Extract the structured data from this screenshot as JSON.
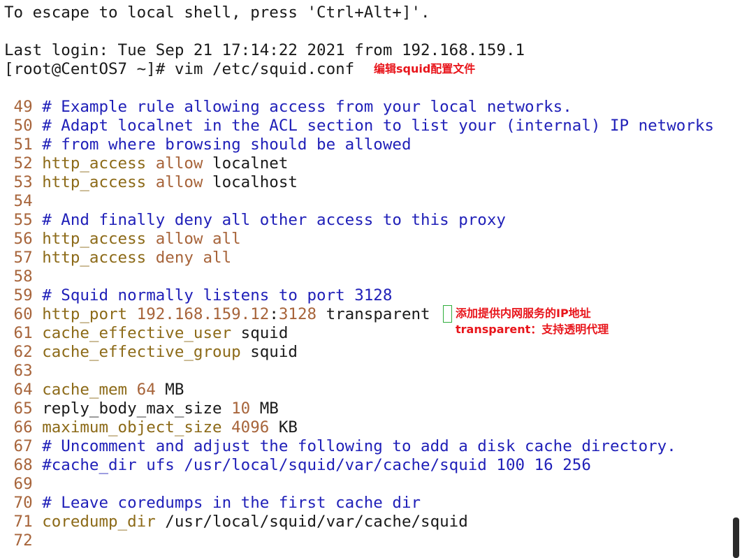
{
  "terminal": {
    "escape_notice": "To escape to local shell, press 'Ctrl+Alt+]'.",
    "last_login": "Last login: Tue Sep 21 17:14:22 2021 from 192.168.159.1",
    "prompt": "[root@CentOS7 ~]# vim /etc/squid.conf"
  },
  "annotations": {
    "edit_config": "编辑squid配置文件",
    "ip_note": "添加提供内网服务的IP地址",
    "transparent_note": "transparent：支持透明代理"
  },
  "colors": {
    "comment": "#1f1fb8",
    "keyword": "#8c6a18",
    "value": "#a7643a",
    "line_number": "#a7643a",
    "annotation": "#e8151b",
    "cursor": "#2fae3c"
  },
  "file_lines": [
    {
      "num": " 49",
      "tokens": [
        {
          "t": "# Example rule allowing access from your local networks.",
          "c": "comment"
        }
      ]
    },
    {
      "num": " 50",
      "tokens": [
        {
          "t": "# Adapt localnet in the ACL section to list your (internal) IP networks",
          "c": "comment"
        }
      ]
    },
    {
      "num": " 51",
      "tokens": [
        {
          "t": "# from where browsing should be allowed",
          "c": "comment"
        }
      ]
    },
    {
      "num": " 52",
      "tokens": [
        {
          "t": "http_access ",
          "c": "key"
        },
        {
          "t": "allow",
          "c": "val"
        },
        {
          "t": " localnet",
          "c": "plain"
        }
      ]
    },
    {
      "num": " 53",
      "tokens": [
        {
          "t": "http_access ",
          "c": "key"
        },
        {
          "t": "allow",
          "c": "val"
        },
        {
          "t": " localhost",
          "c": "plain"
        }
      ]
    },
    {
      "num": " 54",
      "tokens": []
    },
    {
      "num": " 55",
      "tokens": [
        {
          "t": "# And finally deny all other access to this proxy",
          "c": "comment"
        }
      ]
    },
    {
      "num": " 56",
      "tokens": [
        {
          "t": "http_access ",
          "c": "key"
        },
        {
          "t": "allow all",
          "c": "val"
        }
      ]
    },
    {
      "num": " 57",
      "tokens": [
        {
          "t": "http_access ",
          "c": "key"
        },
        {
          "t": "deny all",
          "c": "val"
        }
      ]
    },
    {
      "num": " 58",
      "tokens": []
    },
    {
      "num": " 59",
      "tokens": [
        {
          "t": "# Squid normally listens to port 3128",
          "c": "comment"
        }
      ]
    },
    {
      "num": " 60",
      "tokens": [
        {
          "t": "http_port ",
          "c": "key"
        },
        {
          "t": "192.168.159.12",
          "c": "val"
        },
        {
          "t": ":",
          "c": "plain"
        },
        {
          "t": "3128",
          "c": "val"
        },
        {
          "t": " transparent",
          "c": "plain"
        }
      ]
    },
    {
      "num": " 61",
      "tokens": [
        {
          "t": "cache_effective_user",
          "c": "key"
        },
        {
          "t": " squid",
          "c": "plain"
        }
      ]
    },
    {
      "num": " 62",
      "tokens": [
        {
          "t": "cache_effective_group",
          "c": "key"
        },
        {
          "t": " squid",
          "c": "plain"
        }
      ]
    },
    {
      "num": " 63",
      "tokens": []
    },
    {
      "num": " 64",
      "tokens": [
        {
          "t": "cache_mem ",
          "c": "key"
        },
        {
          "t": "64",
          "c": "val"
        },
        {
          "t": " MB",
          "c": "plain"
        }
      ]
    },
    {
      "num": " 65",
      "tokens": [
        {
          "t": "reply_body_max_size ",
          "c": "plain"
        },
        {
          "t": "10",
          "c": "val"
        },
        {
          "t": " MB",
          "c": "plain"
        }
      ]
    },
    {
      "num": " 66",
      "tokens": [
        {
          "t": "maximum_object_size ",
          "c": "key"
        },
        {
          "t": "4096",
          "c": "val"
        },
        {
          "t": " KB",
          "c": "plain"
        }
      ]
    },
    {
      "num": " 67",
      "tokens": [
        {
          "t": "# Uncomment and adjust the following to add a disk cache directory.",
          "c": "comment"
        }
      ]
    },
    {
      "num": " 68",
      "tokens": [
        {
          "t": "#cache_dir ufs /usr/local/squid/var/cache/squid 100 16 256",
          "c": "comment"
        }
      ]
    },
    {
      "num": " 69",
      "tokens": []
    },
    {
      "num": " 70",
      "tokens": [
        {
          "t": "# Leave coredumps in the first cache dir",
          "c": "comment"
        }
      ]
    },
    {
      "num": " 71",
      "tokens": [
        {
          "t": "coredump_dir",
          "c": "key"
        },
        {
          "t": " /usr/local/squid/var/cache/squid",
          "c": "plain"
        }
      ]
    },
    {
      "num": " 72",
      "tokens": []
    }
  ]
}
